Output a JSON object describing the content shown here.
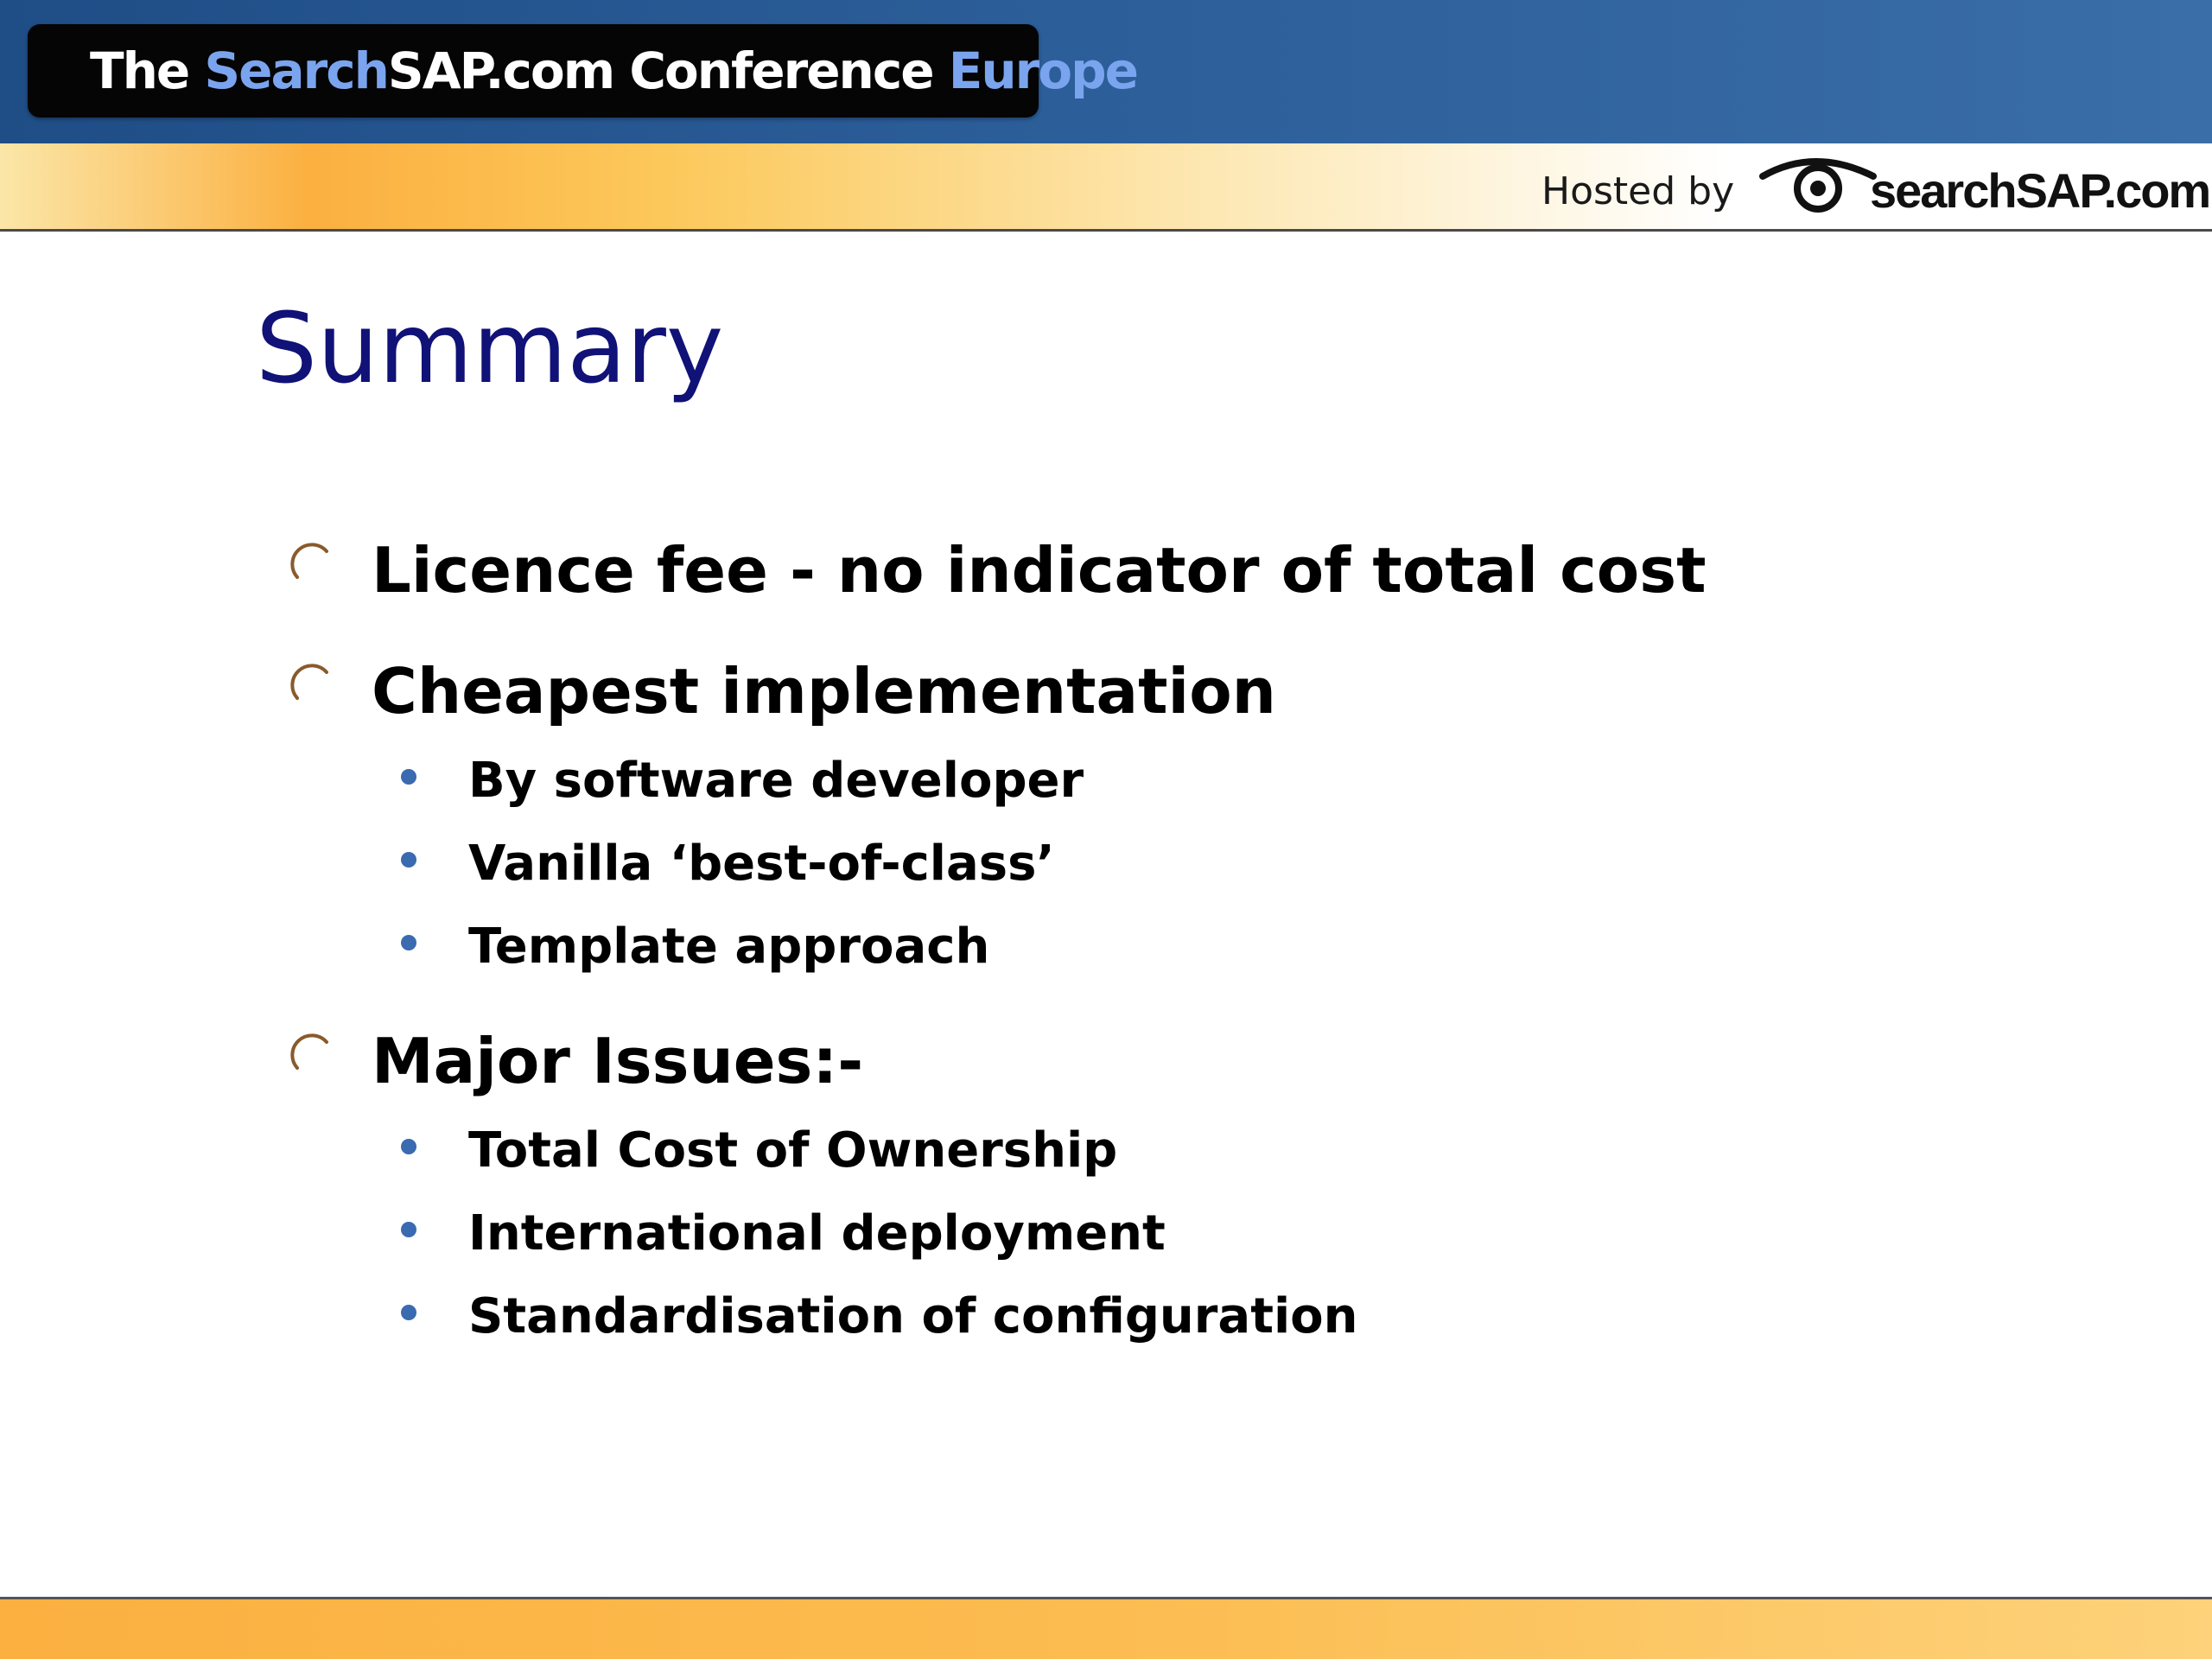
{
  "header": {
    "title_parts": {
      "the": "The ",
      "search": "Search",
      "sap": "SAP.com",
      "conference": " Conference ",
      "europe": "Europe"
    },
    "hosted_by": "Hosted by",
    "logo_text": "searchSAP.com",
    "colors": {
      "blue_band": "#2b5d98",
      "orange_band": "#fbb040",
      "title_highlight": "#7aa4ee"
    }
  },
  "slide": {
    "title": "Summary",
    "title_color": "#101277",
    "bullets": [
      {
        "text": "Licence fee - no indicator of total cost",
        "icon": "arc-bullet-icon",
        "children": []
      },
      {
        "text": "Cheapest implementation",
        "icon": "arc-bullet-icon",
        "children": [
          "By software developer",
          "Vanilla ‘best-of-class’",
          "Template approach"
        ]
      },
      {
        "text": "Major Issues:-",
        "icon": "arc-bullet-icon",
        "children": [
          "Total Cost of Ownership",
          "International deployment",
          "Standardisation of configuration"
        ]
      }
    ],
    "sub_bullet_color": "#3a6ab0",
    "arc_bullet_color": "#8a5a2b"
  }
}
